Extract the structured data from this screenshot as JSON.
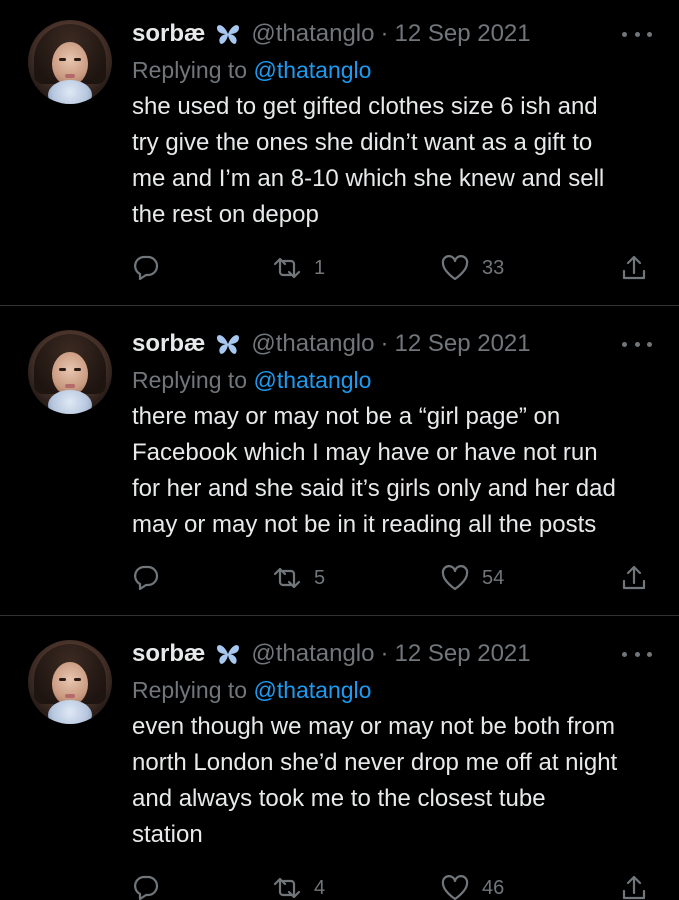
{
  "colors": {
    "background": "#000000",
    "text": "#e7e9ea",
    "muted": "#71767b",
    "link": "#1d9bf0",
    "butterfly": "#a8c8f0",
    "divider": "#2f3336"
  },
  "icons": {
    "badge": "butterfly-icon",
    "more": "more-dots-icon",
    "reply": "reply-icon",
    "retweet": "retweet-icon",
    "like": "heart-icon",
    "share": "share-icon"
  },
  "tweets": [
    {
      "name": "sorbæ",
      "handle": "@thatanglo",
      "separator": "·",
      "date": "12 Sep 2021",
      "replying_prefix": "Replying to",
      "replying_to": "@thatanglo",
      "text": "she used to get gifted clothes size 6 ish and\ntry give the ones she didn’t want as a gift to\nme and I’m an 8-10 which she knew and sell\nthe rest on depop",
      "retweets": "1",
      "likes": "33"
    },
    {
      "name": "sorbæ",
      "handle": "@thatanglo",
      "separator": "·",
      "date": "12 Sep 2021",
      "replying_prefix": "Replying to",
      "replying_to": "@thatanglo",
      "text": "there may or may not be a “girl page” on\nFacebook which I may have or have not run\nfor her and she said it’s girls only and her dad\nmay or may not be in it reading all the posts",
      "retweets": "5",
      "likes": "54"
    },
    {
      "name": "sorbæ",
      "handle": "@thatanglo",
      "separator": "·",
      "date": "12 Sep 2021",
      "replying_prefix": "Replying to",
      "replying_to": "@thatanglo",
      "text": "even though we may or may not be both from\nnorth London she’d never drop me off at night\nand always took me to the closest tube\nstation",
      "retweets": "4",
      "likes": "46"
    }
  ]
}
